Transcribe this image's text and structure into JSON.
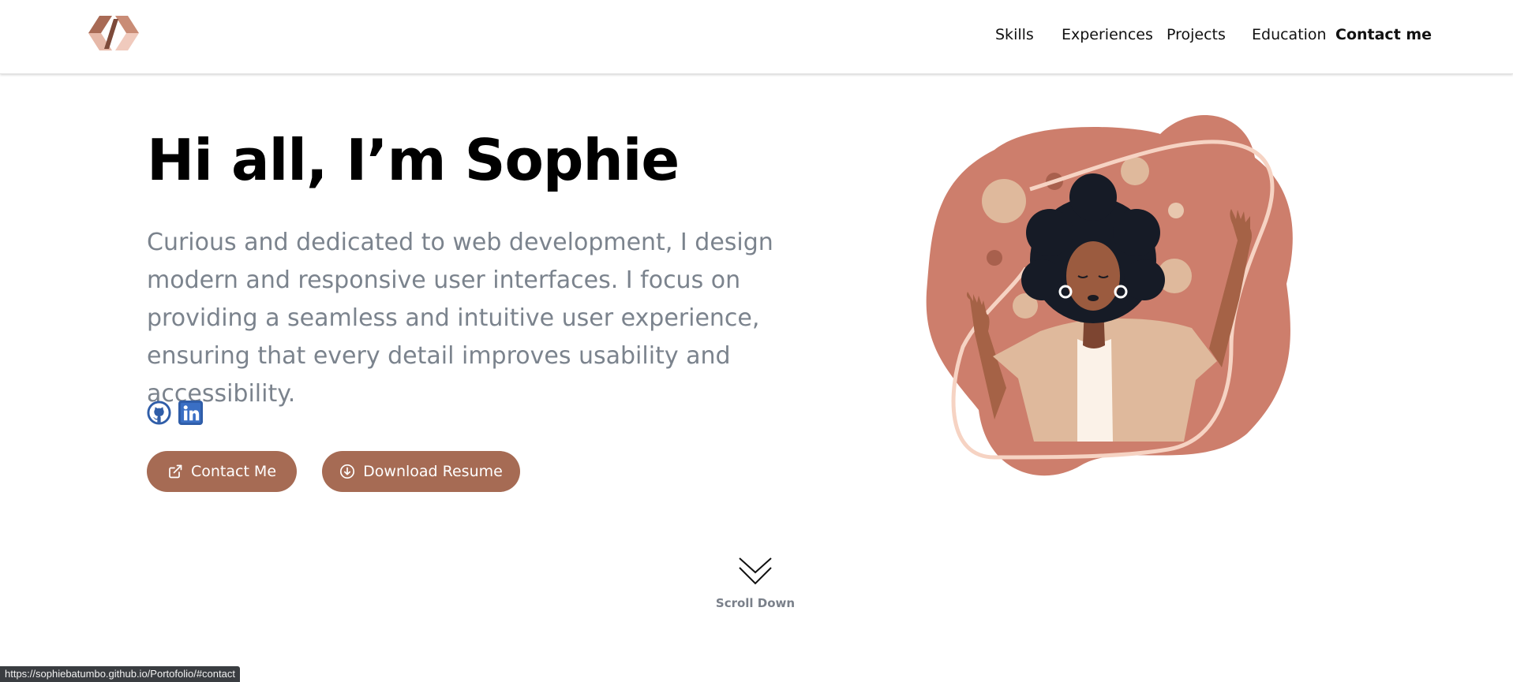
{
  "nav": {
    "items": [
      {
        "label": "Skills"
      },
      {
        "label": "Experiences"
      },
      {
        "label": "Projects"
      },
      {
        "label": "Education"
      },
      {
        "label": "Contact me",
        "active": true
      }
    ]
  },
  "hero": {
    "title": "Hi all, I’m Sophie",
    "bio": "Curious and dedicated to web development, I design modern and responsive user interfaces. I focus on providing a seamless and intuitive user experience, ensuring that every detail improves usability and accessibility.",
    "socials": [
      {
        "icon": "github-icon"
      },
      {
        "icon": "linkedin-icon"
      }
    ],
    "buttons": {
      "contact_label": "Contact Me",
      "resume_label": "Download Resume"
    }
  },
  "scroll": {
    "label": "Scroll Down"
  },
  "status_bar": {
    "url": "https://sophiebatumbo.github.io/Portofolio/#contact"
  },
  "colors": {
    "accent": "#a66b54",
    "blob": "#cd7e6c",
    "muted_text": "#7b838d",
    "nav_text": "#111111"
  }
}
